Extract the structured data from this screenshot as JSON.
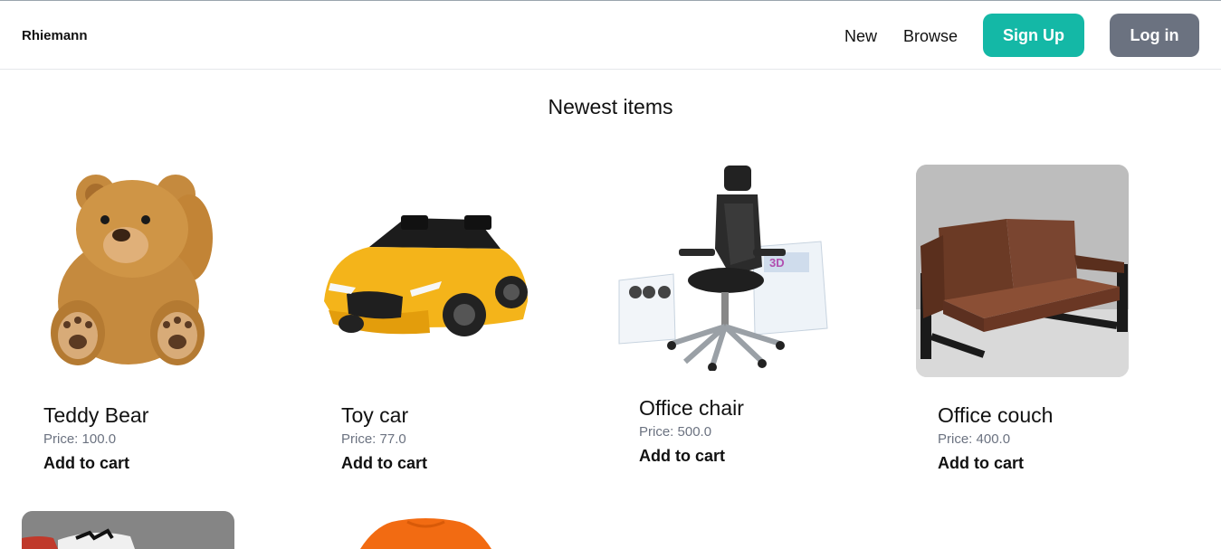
{
  "nav": {
    "brand": "Rhiemann",
    "links": [
      "New",
      "Browse"
    ],
    "signup_label": "Sign Up",
    "login_label": "Log in"
  },
  "main": {
    "heading": "Newest items",
    "items": [
      {
        "name": "Teddy Bear",
        "price": "Price: 100.0",
        "action": "Add to cart",
        "image": "teddy-bear"
      },
      {
        "name": "Toy car",
        "price": "Price: 77.0",
        "action": "Add to cart",
        "image": "toy-car"
      },
      {
        "name": "Office chair",
        "price": "Price: 500.0",
        "action": "Add to cart",
        "image": "office-chair"
      },
      {
        "name": "Office couch",
        "price": "Price: 400.0",
        "action": "Add to cart",
        "image": "office-couch"
      },
      {
        "name": "",
        "price": "",
        "action": "",
        "image": "sneakers"
      },
      {
        "name": "",
        "price": "",
        "action": "",
        "image": "orange-tshirt"
      }
    ]
  },
  "colors": {
    "signup_bg": "#14b8a6",
    "login_bg": "#6b7280",
    "price_text": "#6b7280"
  }
}
